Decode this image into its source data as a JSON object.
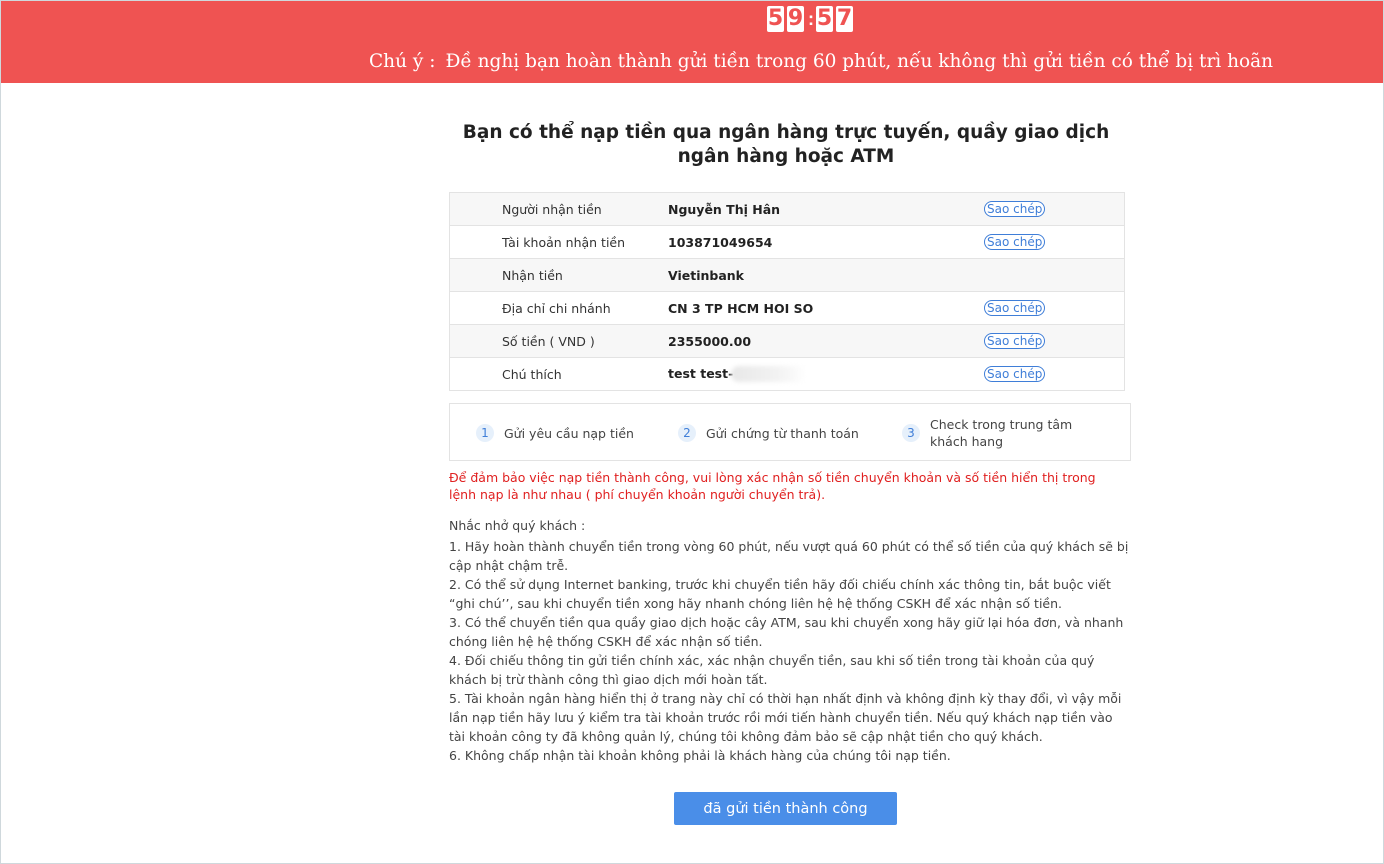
{
  "countdown": {
    "d1": "5",
    "d2": "9",
    "separator": ":",
    "d3": "5",
    "d4": "7"
  },
  "banner": {
    "notice_prefix": "Chú ý :",
    "notice_text": "Đề nghị bạn hoàn thành gửi tiền trong 60 phút, nếu không thì gửi tiền có thể bị trì hoãn"
  },
  "title": "Bạn có thể nạp tiền qua ngân hàng trực tuyến, quầy giao dịch ngân hàng hoặc ATM",
  "info": {
    "copy_label": "Sao chép",
    "rows": [
      {
        "label": "Người nhận tiền",
        "value": "Nguyễn Thị Hân"
      },
      {
        "label": "Tài khoản nhận tiền",
        "value": "103871049654"
      },
      {
        "label": "Nhận tiền",
        "value": "Vietinbank"
      },
      {
        "label": "Địa chỉ chi nhánh",
        "value": "CN 3 TP HCM HOI SO"
      },
      {
        "label": "Số tiền ( VND )",
        "value": "2355000.00"
      },
      {
        "label": "Chú thích",
        "value": "test test-"
      }
    ]
  },
  "steps": [
    {
      "num": "1",
      "text": "Gửi yêu cầu nạp tiền"
    },
    {
      "num": "2",
      "text": "Gửi chứng từ thanh toán"
    },
    {
      "num": "3",
      "text": "Check trong trung tâm khách hang"
    }
  ],
  "warning": "Để đảm bảo việc nạp tiền thành công, vui lòng xác nhận số tiền chuyển khoản và số tiền hiển thị trong lệnh nạp là như nhau ( phí chuyển khoản người chuyển trả).",
  "reminders": {
    "title": "Nhắc nhở quý khách :",
    "items": [
      "1. Hãy hoàn thành chuyển tiền trong vòng 60 phút, nếu vượt quá 60 phút có thể số tiền của quý khách sẽ bị cập nhật chậm trễ.",
      "2. Có thể sử dụng Internet banking, trước khi chuyển tiền hãy đối chiếu chính xác thông tin, bắt buộc viết “ghi chú’’, sau khi chuyển tiền xong hãy nhanh chóng liên hệ hệ thống CSKH để xác nhận số tiền.",
      "3. Có thể chuyển tiền qua quầy giao dịch hoặc cây ATM, sau khi chuyển xong hãy giữ lại hóa đơn, và nhanh chóng liên hệ hệ thống CSKH để xác nhận số tiền.",
      "4. Đối chiếu thông tin gửi tiền chính xác, xác nhận chuyển tiền, sau khi số tiền trong tài khoản của quý khách bị trừ thành công thì giao dịch mới hoàn tất.",
      "5. Tài khoản ngân hàng hiển thị ở trang này chỉ có thời hạn nhất định và không định kỳ thay đổi, vì vậy mỗi lần nạp tiền hãy lưu ý kiểm tra tài khoản trước rồi mới tiến hành chuyển tiền. Nếu quý khách nạp tiền vào tài khoản công ty đã không quản lý, chúng tôi không đảm bảo sẽ cập nhật tiền cho quý khách.",
      "6. Không chấp nhận tài khoản không phải là khách hàng của chúng tôi nạp tiền."
    ]
  },
  "submit_label": "đã gửi tiền thành công",
  "colors": {
    "banner": "#ef5352",
    "accent": "#4a8ee8",
    "warning": "#e02020"
  }
}
